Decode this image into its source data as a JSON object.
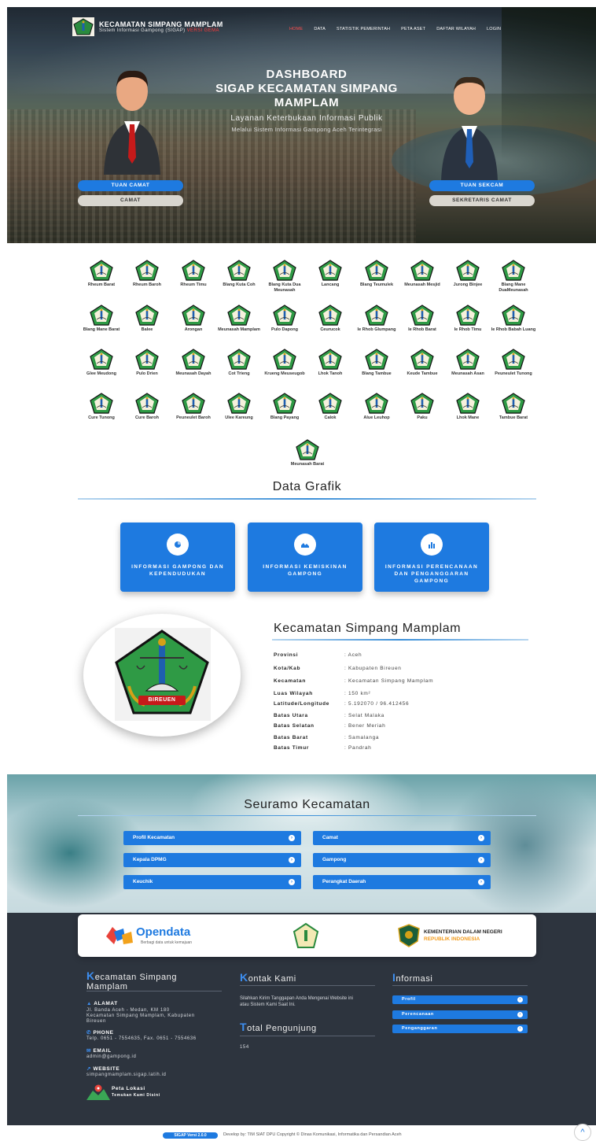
{
  "header": {
    "title": "KECAMATAN SIMPANG MAMPLAM",
    "subtitle_prefix": "Sistem Informasi Gampong (SIGAP)",
    "subtitle_red": "VERSI GEMA",
    "nav": [
      "HOME",
      "DATA",
      "STATISTIK PEMERINTAH",
      "PETA ASET",
      "DAFTAR WILAYAH",
      "LOGIN"
    ]
  },
  "hero": {
    "title_line1": "DASHBOARD",
    "title_line2": "SIGAP KECAMATAN SIMPANG",
    "title_line3": "MAMPLAM",
    "sub1": "Layanan Keterbukaan Informasi Publik",
    "sub2": "Melalui Sistem Informasi Gampong Aceh Terintegrasi",
    "left_name": "TUAN CAMAT",
    "left_role": "CAMAT",
    "right_name": "TUAN SEKCAM",
    "right_role": "SEKRETARIS CAMAT"
  },
  "villages": [
    "Rheum Barat",
    "Rheum Baroh",
    "Rheum Timu",
    "Blang Kuta Coh",
    "Blang Kuta Dua Meunasah",
    "Lancang",
    "Blang Teumulek",
    "Meunasah Mesjid",
    "Jurong Binjee",
    "Blang Mane DuaMeunasah",
    "Blang Mane Barat",
    "Balee",
    "Arongan",
    "Meunasah Mamplam",
    "Pulo Dapong",
    "Ceurucok",
    "Ie Rhob Glumpang",
    "Ie Rhob Barat",
    "Ie Rhob Timu",
    "Ie Rhob Babah Luang",
    "Glee Meudong",
    "Pulo Drien",
    "Meunasah Dayah",
    "Cot Trieng",
    "Krueng Meuseugob",
    "Lhok Tanoh",
    "Blang Tambue",
    "Keude Tambue",
    "Meunasah Asan",
    "Peuneulet Tunong",
    "Cure Tunong",
    "Cure Baroh",
    "Peuneulet Baroh",
    "Ulee Kareung",
    "Blang Payang",
    "Calok",
    "Alue Leuhop",
    "Paku",
    "Lhok Mane",
    "Tambue Barat",
    "Meunasah Barat"
  ],
  "grafik": {
    "heading": "Data Grafik",
    "cards": [
      {
        "label": "INFORMASI GAMPONG DAN KEPENDUDUKAN",
        "icon": "pie-chart-icon"
      },
      {
        "label": "INFORMASI KEMISKINAN GAMPONG",
        "icon": "area-chart-icon"
      },
      {
        "label": "INFORMASI PERENCANAAN DAN PENGANGGARAN GAMPONG",
        "icon": "bar-chart-icon"
      }
    ]
  },
  "profile": {
    "title": "Kecamatan Simpang Mamplam",
    "emblem_text": "BIREUEN",
    "rows": [
      {
        "k": "Provinsi",
        "v": ": Aceh"
      },
      {
        "k": "Kota/Kab",
        "v": ": Kabupaten Bireuen"
      },
      {
        "k": "Kecamatan",
        "v": ": Kecamatan Simpang Mamplam"
      },
      {
        "k": "Luas Wilayah",
        "v": ": 150 km²"
      },
      {
        "k": "Latitude/Longitude",
        "v": ": 5.192070 / 96.412456"
      },
      {
        "k": "Batas Utara",
        "v": ": Selat Malaka"
      },
      {
        "k": "Batas Selatan",
        "v": ": Bener Meriah"
      },
      {
        "k": "Batas Barat",
        "v": ": Samalanga"
      },
      {
        "k": "Batas Timur",
        "v": ": Pandrah"
      }
    ]
  },
  "seuramo": {
    "heading": "Seuramo Kecamatan",
    "buttons": [
      "Profil Kecamatan",
      "Camat",
      "Kepala DPMG",
      "Gampong",
      "Keuchik",
      "Perangkat Daerah"
    ]
  },
  "partners": {
    "opendata": "Opendata",
    "opendata_tag": "Berbagi data untuk kemajuan",
    "kemendagri_1": "KEMENTERIAN DALAM NEGERI",
    "kemendagri_2": "REPUBLIK INDONESIA"
  },
  "footer": {
    "col1_initial": "K",
    "col1_title": "ecamatan Simpang",
    "col1_title2": "Mamplam",
    "alamat_label": "ALAMAT",
    "alamat": "Jl. Banda Aceh - Medan, KM 180",
    "alamat2": "Kecamatan Simpang Mamplam, Kabupaten",
    "alamat3": "Bireuen",
    "phone_label": "PHONE",
    "phone": "Telp. 0651 - 7554635, Fax. 0651 - 7554636",
    "email_label": "EMAIL",
    "email": "admin@gampong.id",
    "website_label": "WEBSITE",
    "website": "simpangmamplam.sigap.latih.id",
    "map_label": "Peta Lokasi",
    "map_sub": "Temukan Kami Disini",
    "col2_initial": "K",
    "col2_title": "ontak Kami",
    "kontak_text": "Silahkan Kirim Tanggapan Anda Mengenai Website ini",
    "kontak_text2": "atau Sistem Kami Saat Ini.",
    "visitors_initial": "T",
    "visitors_title": "otal Pengunjung",
    "visitors": "154",
    "col3_initial": "I",
    "col3_title": "nformasi",
    "links": [
      "Profil",
      "Perencanaan",
      "Penganggaran"
    ]
  },
  "bottom": {
    "badge": "SIGAP Versi 2.0.0",
    "copyright": "Develop by: TIM SIAT DPU Copyright © Dinas Komunikasi, Informatika dan Persandian Aceh"
  }
}
